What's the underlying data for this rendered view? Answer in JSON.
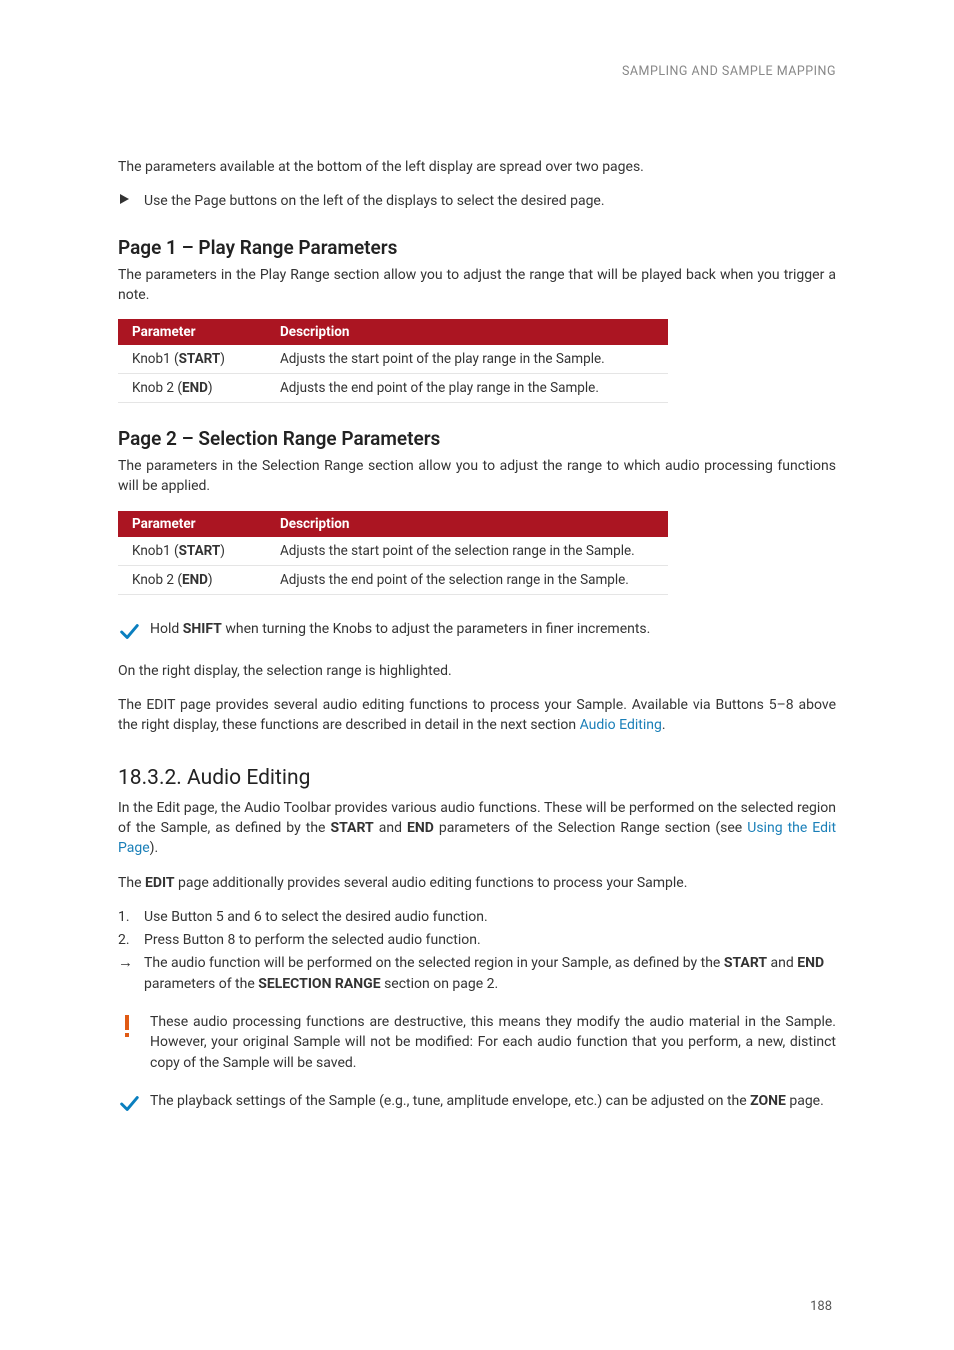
{
  "breadcrumb": "SAMPLING AND SAMPLE MAPPING",
  "intro_para": "The parameters available at the bottom of the left display are spread over two pages.",
  "caret_para": "Use the Page buttons on the left of the displays to select the desired page.",
  "page1": {
    "heading": "Page 1 – Play Range Parameters",
    "para": "The parameters in the Play Range section allow you to adjust the range that will be played back when you trigger a note.",
    "table": {
      "head_param": "Parameter",
      "head_desc": "Description",
      "rows": [
        {
          "param_prefix": "Knob1 (",
          "param_bold": "START",
          "param_suffix": ")",
          "desc": "Adjusts the start point of the play range in the Sample."
        },
        {
          "param_prefix": "Knob 2 (",
          "param_bold": "END",
          "param_suffix": ")",
          "desc": "Adjusts the end point of the play range in the Sample."
        }
      ]
    }
  },
  "page2": {
    "heading": "Page 2 – Selection Range Parameters",
    "para": "The parameters in the Selection Range section allow you to adjust the range to which audio processing functions will be applied.",
    "table": {
      "head_param": "Parameter",
      "head_desc": "Description",
      "rows": [
        {
          "param_prefix": "Knob1 (",
          "param_bold": "START",
          "param_suffix": ")",
          "desc": "Adjusts the start point of the selection range in the Sample."
        },
        {
          "param_prefix": "Knob 2 (",
          "param_bold": "END",
          "param_suffix": ")",
          "desc": "Adjusts the end point of the selection range in the Sample."
        }
      ]
    }
  },
  "tip_shift_pre": "Hold ",
  "tip_shift_bold": "SHIFT",
  "tip_shift_post": " when turning the Knobs to adjust the parameters in finer increments.",
  "para_right_display": "On the right display, the selection range is highlighted.",
  "para_edit_page_1": "The EDIT page provides several audio editing functions to process your Sample. Available via Buttons 5–8 above the right display, these functions are described in detail in the next section ",
  "para_edit_link": "Audio Editing",
  "para_edit_page_2": ".",
  "section_1832": {
    "heading": "18.3.2. Audio Editing",
    "p1_a": "In the Edit page, the Audio Toolbar provides various audio functions. These will be performed on the selected region of the Sample, as defined by the ",
    "p1_b": "START",
    "p1_c": " and ",
    "p1_d": "END",
    "p1_e": " parameters of the Selection Range section (see ",
    "p1_link": "Using the Edit Page",
    "p1_f": ").",
    "p2_a": "The ",
    "p2_b": "EDIT",
    "p2_c": " page additionally provides several audio editing functions to process your Sample.",
    "steps": {
      "s1": "Use Button 5 and 6 to select the desired audio function.",
      "s2": "Press Button 8 to perform the selected audio function.",
      "s3_a": "The audio function will be performed on the selected region in your Sample, as defined by the ",
      "s3_b": "START",
      "s3_c": " and ",
      "s3_d": "END",
      "s3_e": " parameters of the ",
      "s3_f": "SELECTION RANGE",
      "s3_g": " section on page 2.",
      "num1": "1.",
      "num2": "2.",
      "arrow": "→"
    },
    "warn": "These audio processing functions are destructive, this means they modify the audio material in the Sample. However, your original Sample will not be modified: For each audio function that you perform, a new, distinct copy of the Sample will be saved.",
    "tip_a": "The playback settings of the Sample (e.g., tune, amplitude envelope, etc.) can be adjusted on the ",
    "tip_b": "ZONE",
    "tip_c": " page."
  },
  "page_number": "188"
}
